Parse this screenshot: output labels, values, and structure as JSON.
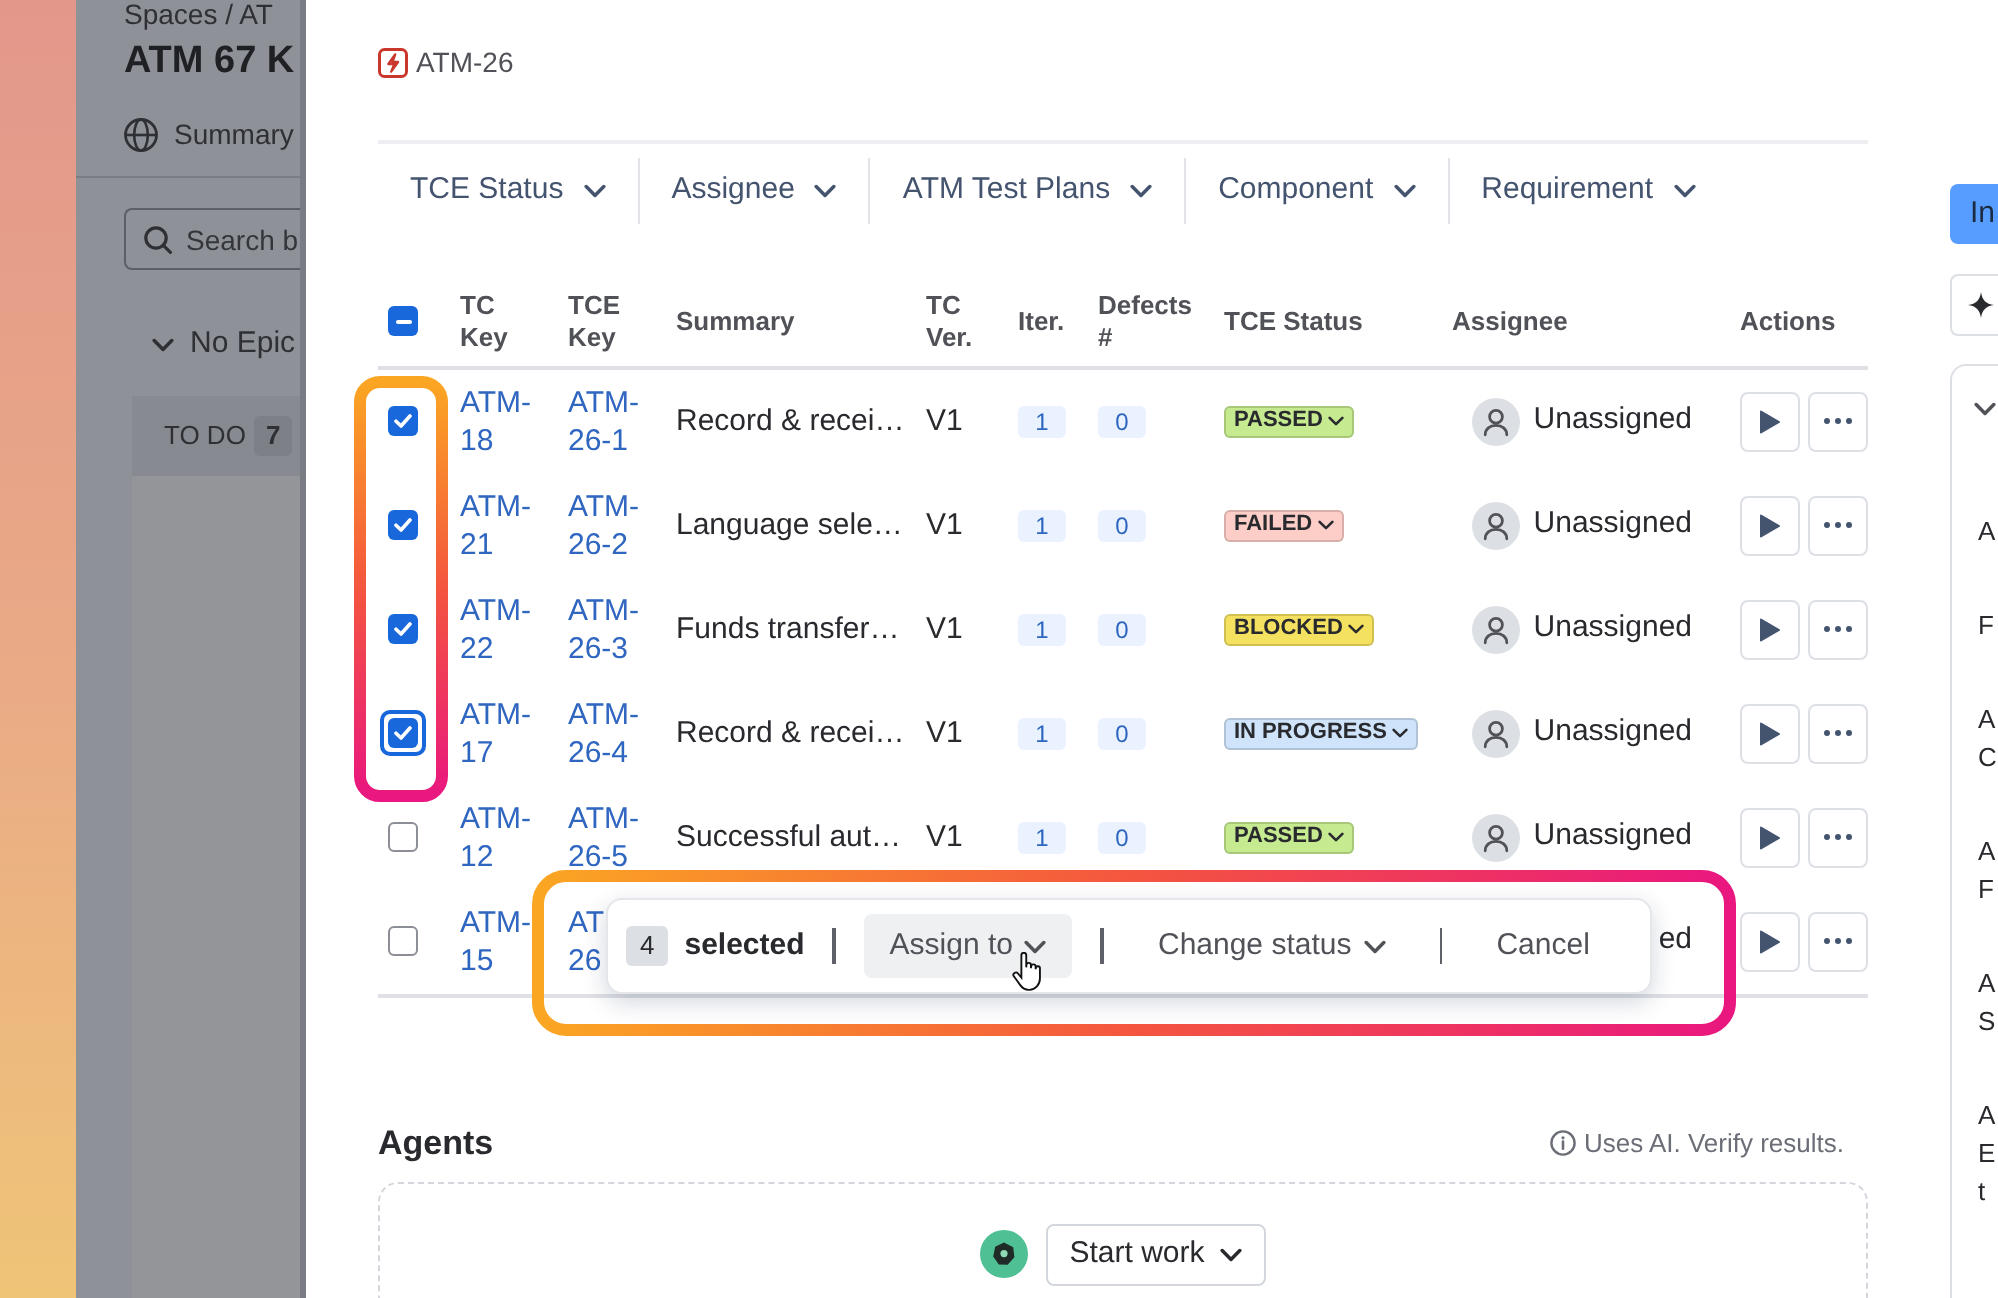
{
  "background_page": {
    "breadcrumb": "Spaces / AT",
    "title": "ATM 67 K",
    "tab": "Summary",
    "search": {
      "placeholder": "Search b"
    },
    "group": {
      "label": "No Epic",
      "expanded": true
    },
    "column": {
      "label": "TO DO",
      "count": "7"
    }
  },
  "work_item": {
    "key": "ATM-26"
  },
  "filters": [
    "TCE Status",
    "Assignee",
    "ATM Test Plans",
    "Component",
    "Requirement"
  ],
  "table": {
    "select_all": {
      "indeterminate": true
    },
    "columns": [
      "TC Key",
      "TCE Key",
      "Summary",
      "TC Ver.",
      "Iter.",
      "Defects #",
      "TCE Status",
      "Assignee",
      "Actions"
    ],
    "rows": [
      {
        "selected": true,
        "focused": false,
        "tc_key": "ATM-18",
        "tce_key": "ATM-26-1",
        "summary": "Record & recei…",
        "version": "V1",
        "iteration": "1",
        "defects": "0",
        "status": {
          "label": "PASSED",
          "color": "#c6ea8f"
        },
        "assignee": {
          "name": "Unassigned",
          "avatar": true
        }
      },
      {
        "selected": true,
        "focused": false,
        "tc_key": "ATM-21",
        "tce_key": "ATM-26-2",
        "summary": "Language sele…",
        "version": "V1",
        "iteration": "1",
        "defects": "0",
        "status": {
          "label": "FAILED",
          "color": "#fdcdc8"
        },
        "assignee": {
          "name": "Unassigned",
          "avatar": true
        }
      },
      {
        "selected": true,
        "focused": false,
        "tc_key": "ATM-22",
        "tce_key": "ATM-26-3",
        "summary": "Funds transfer…",
        "version": "V1",
        "iteration": "1",
        "defects": "0",
        "status": {
          "label": "BLOCKED",
          "color": "#f5e160"
        },
        "assignee": {
          "name": "Unassigned",
          "avatar": true
        }
      },
      {
        "selected": true,
        "focused": true,
        "tc_key": "ATM-17",
        "tce_key": "ATM-26-4",
        "summary": "Record & recei…",
        "version": "V1",
        "iteration": "1",
        "defects": "0",
        "status": {
          "label": "IN PROGRESS",
          "color": "#cfe4fb"
        },
        "assignee": {
          "name": "Unassigned",
          "avatar": true
        }
      },
      {
        "selected": false,
        "focused": false,
        "tc_key": "ATM-12",
        "tce_key": "ATM-26-5",
        "summary": "Successful aut…",
        "version": "V1",
        "iteration": "1",
        "defects": "0",
        "status": {
          "label": "PASSED",
          "color": "#c6ea8f"
        },
        "assignee": {
          "name": "Unassigned",
          "avatar": true
        }
      },
      {
        "selected": false,
        "focused": false,
        "tc_key": "ATM-15",
        "tce_key": "AT 26",
        "assignee": {
          "name": "ed",
          "avatar": false
        }
      }
    ]
  },
  "bulk_actions": {
    "count": "4",
    "label": "selected",
    "actions": [
      {
        "label": "Assign to",
        "hovered": true
      },
      {
        "label": "Change status",
        "hovered": false
      }
    ],
    "cancel": "Cancel"
  },
  "agents": {
    "title": "Agents",
    "notice": "Uses AI. Verify results.",
    "button": "Start work"
  },
  "side_panel": {
    "button": "In",
    "expanded": true,
    "items": [
      "A",
      "F",
      "A C",
      "A F",
      "A S",
      "A E t"
    ]
  }
}
